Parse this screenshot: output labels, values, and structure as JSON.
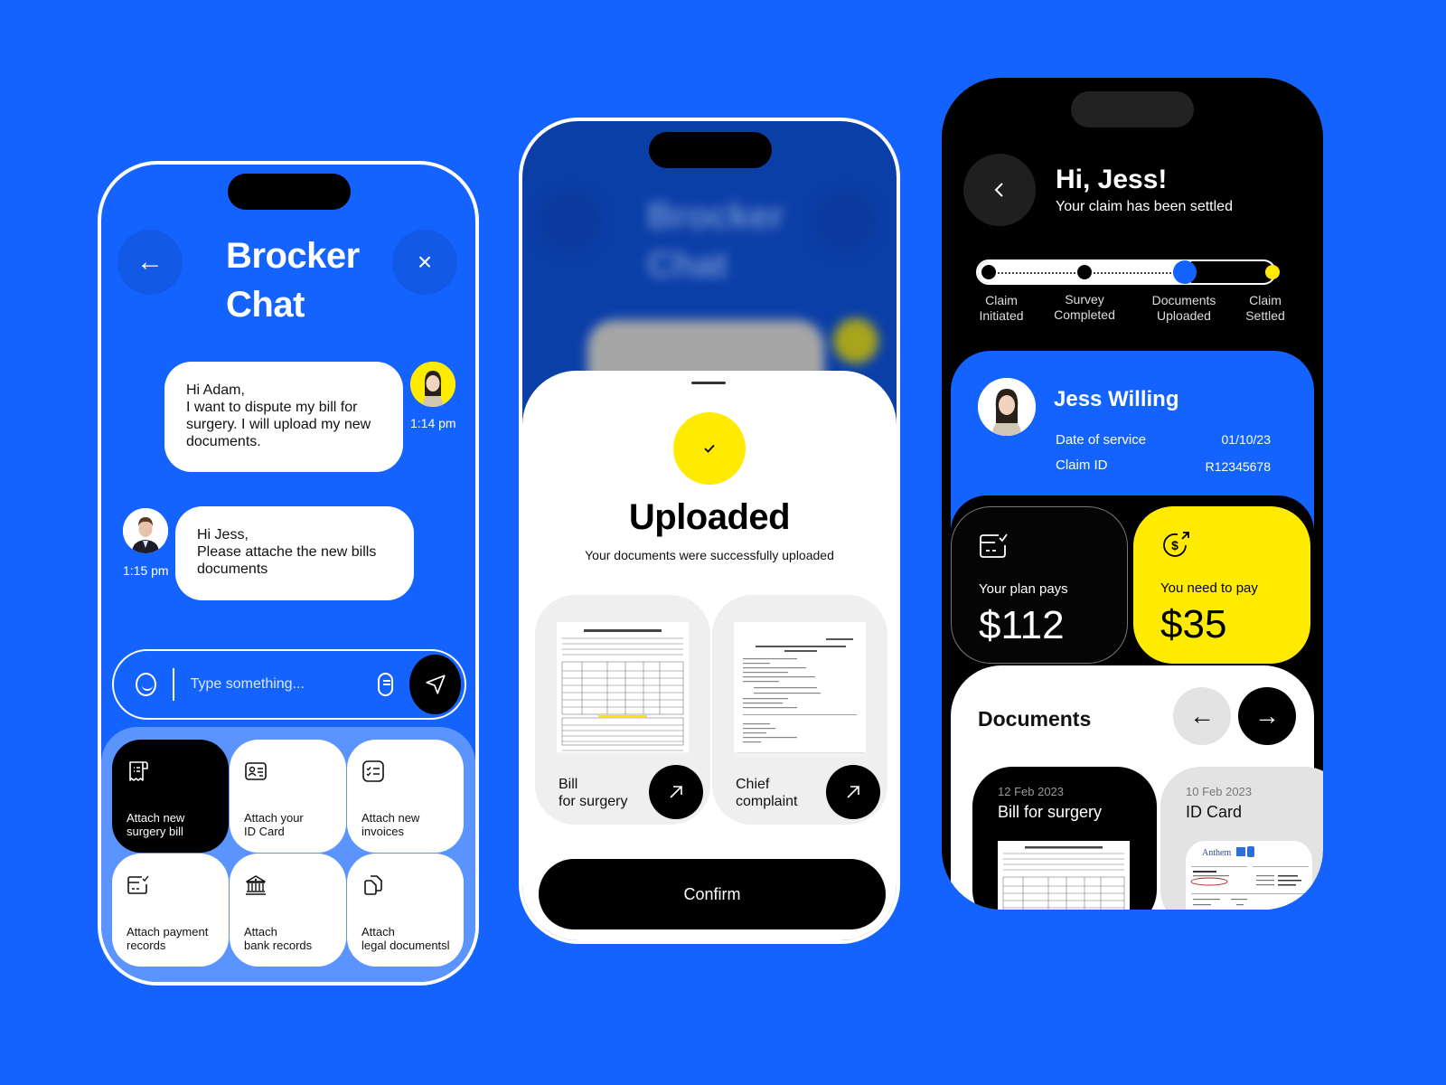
{
  "colors": {
    "background": "#1463FF",
    "accent_yellow": "#FFEB00",
    "black": "#000000",
    "white": "#FFFFFF",
    "panel_blue": "#5B93FF"
  },
  "chat_screen": {
    "title_line1": "Brocker",
    "title_line2": "Chat",
    "back_icon": "arrow-left-icon",
    "close_icon": "close-icon",
    "back_glyph": "←",
    "close_glyph": "×",
    "messages": [
      {
        "sender": "Jess",
        "text": "Hi Adam,\nI want to dispute my bill for surgery. I will upload my new documents.",
        "time": "1:14 pm",
        "side": "right"
      },
      {
        "sender": "Adam",
        "text": "Hi Jess,\nPlease attache the new bills documents",
        "time": "1:15 pm",
        "side": "left"
      }
    ],
    "input": {
      "placeholder": "Type something...",
      "value": ""
    },
    "attach_options": [
      {
        "label": "Attach new\nsurgery bill",
        "icon": "receipt-icon",
        "active": true
      },
      {
        "label": "Attach your\nID Card",
        "icon": "id-card-icon",
        "active": false
      },
      {
        "label": "Attach new\ninvoices",
        "icon": "checklist-icon",
        "active": false
      },
      {
        "label": "Attach payment\nrecords",
        "icon": "card-check-icon",
        "active": false
      },
      {
        "label": "Attach\nbank records",
        "icon": "bank-icon",
        "active": false
      },
      {
        "label": "Attach\nlegal documentsl",
        "icon": "documents-icon",
        "active": false
      }
    ]
  },
  "upload_screen": {
    "background_title_line1": "Brocker",
    "background_title_line2": "Chat",
    "heading": "Uploaded",
    "subheading": "Your documents were successfully uploaded",
    "documents": [
      {
        "label": "Bill\nfor surgery"
      },
      {
        "label": "Chief\ncomplaint"
      }
    ],
    "confirm_label": "Confirm"
  },
  "claim_screen": {
    "greeting": "Hi, Jess!",
    "status": "Your claim has been settled",
    "progress": {
      "completed_fraction": 0.75,
      "steps": [
        {
          "label": "Claim\nInitiated",
          "state": "done"
        },
        {
          "label": "Survey\nCompleted",
          "state": "done"
        },
        {
          "label": "Documents\nUploaded",
          "state": "current"
        },
        {
          "label": "Claim\nSettled",
          "state": "final"
        }
      ]
    },
    "profile": {
      "name": "Jess Willing",
      "date_of_service_label": "Date of service",
      "date_of_service": "01/10/23",
      "claim_id_label": "Claim ID",
      "claim_id": "R12345678"
    },
    "plan_pays_label": "Your plan pays",
    "plan_pays_amount": "$112",
    "you_pay_label": "You need to  pay",
    "you_pay_amount": "$35",
    "documents_title": "Documents",
    "prev_glyph": "←",
    "next_glyph": "→",
    "documents": [
      {
        "date": "12 Feb 2023",
        "name": "Bill for surgery"
      },
      {
        "date": "10 Feb 2023",
        "name": "ID Card"
      }
    ]
  }
}
